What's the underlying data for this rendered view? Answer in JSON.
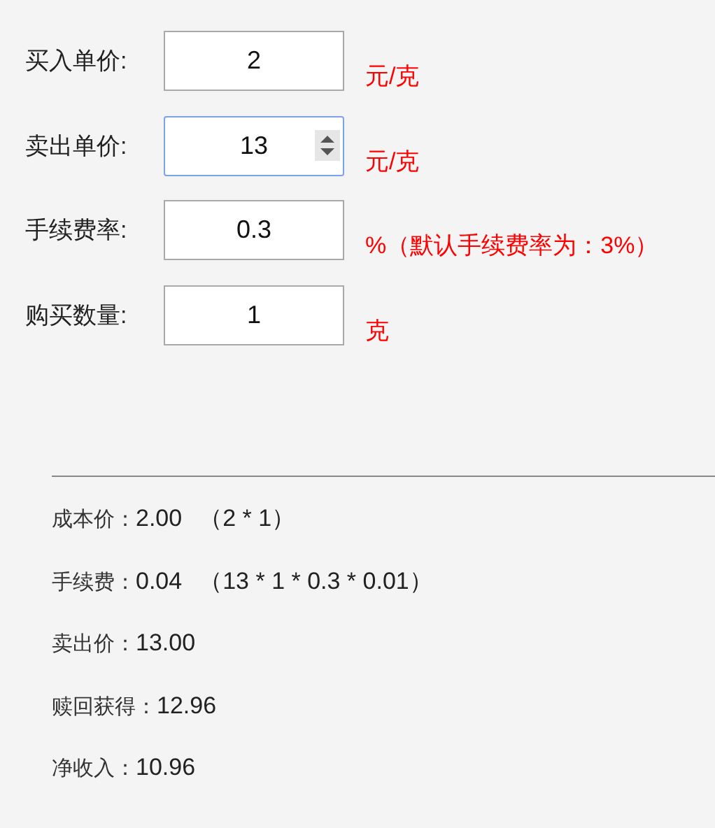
{
  "fields": [
    {
      "label": "买入单价:",
      "value": "2",
      "unit": "元/克",
      "focused": false
    },
    {
      "label": "卖出单价:",
      "value": "13",
      "unit": "元/克",
      "focused": true
    },
    {
      "label": "手续费率:",
      "value": "0.3",
      "unit": "%（默认手续费率为：3%）",
      "focused": false
    },
    {
      "label": "购买数量:",
      "value": "1",
      "unit": "克",
      "focused": false
    }
  ],
  "results": [
    {
      "label": "成本价：",
      "value": "2.00",
      "formula": "（2 * 1）"
    },
    {
      "label": "手续费：",
      "value": "0.04",
      "formula": "（13 * 1 * 0.3 * 0.01）"
    },
    {
      "label": "卖出价：",
      "value": "13.00"
    },
    {
      "label": "赎回获得：",
      "value": "12.96"
    },
    {
      "label": "净收入：",
      "value": "10.96"
    }
  ]
}
